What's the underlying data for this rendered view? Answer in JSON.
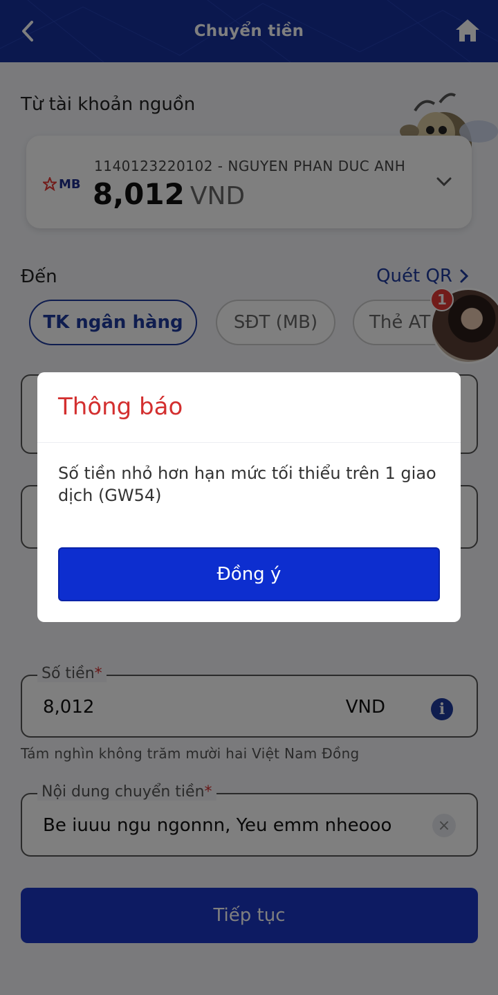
{
  "header": {
    "title": "Chuyển tiền",
    "back_icon": "chevron-left-icon",
    "home_icon": "home-icon"
  },
  "source": {
    "label": "Từ tài khoản nguồn",
    "bank_logo": "MB",
    "account_line": "1140123220102 - NGUYEN PHAN DUC ANH",
    "balance": "8,012",
    "currency": "VND"
  },
  "destination": {
    "label": "Đến",
    "qr_link": "Quét QR",
    "tabs": [
      {
        "label": "TK ngân hàng",
        "active": true
      },
      {
        "label": "SĐT (MB)",
        "active": false
      },
      {
        "label": "Thẻ AT",
        "active": false
      }
    ]
  },
  "chat_head": {
    "badge_count": "1"
  },
  "amount": {
    "legend": "Số tiền",
    "required_mark": "*",
    "value": "8,012",
    "unit": "VND",
    "info_icon": "i",
    "in_words": "Tám nghìn không trăm mười hai Việt Nam Đồng"
  },
  "message": {
    "legend": "Nội dung chuyển tiền",
    "required_mark": "*",
    "value": "Be iuuu ngu ngonnn, Yeu emm nheooo",
    "clear_icon": "×"
  },
  "continue_button": "Tiếp tục",
  "dialog": {
    "title": "Thông báo",
    "message": "Số tiền nhỏ hơn hạn mức tối thiểu trên 1 giao dịch (GW54)",
    "ok_label": "Đồng ý"
  },
  "colors": {
    "primary": "#1b37c4",
    "header": "#16309c",
    "alert": "#d32f2f"
  }
}
